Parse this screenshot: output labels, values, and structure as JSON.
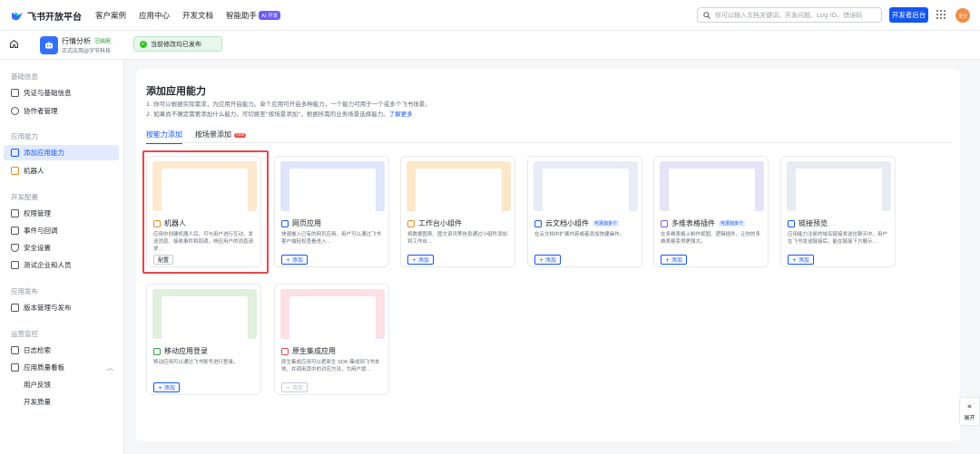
{
  "topbar": {
    "brand": "飞书开放平台",
    "nav": [
      "客户案例",
      "应用中心",
      "开发文档",
      "智能助手"
    ],
    "ai_badge": "AI 开发",
    "search_placeholder": "你可以输入文档关键词、开发问题、Log ID、错误码",
    "dev_button": "开发者后台",
    "avatar_text": "企业"
  },
  "appbar": {
    "app_name": "行情分析",
    "app_tag": "已启用",
    "app_sub": "正式应用@字节科技",
    "publish_status": "当前修改均已发布"
  },
  "sidebar": {
    "sections": [
      {
        "title": "基础信息",
        "items": [
          "凭证与基础信息",
          "协作者管理"
        ]
      },
      {
        "title": "应用能力",
        "items": [
          "添加应用能力",
          "机器人"
        ]
      },
      {
        "title": "开发配置",
        "items": [
          "权限管理",
          "事件与回调",
          "安全设置",
          "测试企业和人员"
        ]
      },
      {
        "title": "应用发布",
        "items": [
          "版本管理与发布"
        ]
      },
      {
        "title": "运营监控",
        "items": [
          "日志检索",
          "应用质量看板",
          "用户反馈",
          "开发质量"
        ]
      }
    ]
  },
  "main": {
    "title": "添加应用能力",
    "desc1": "1. 你可以根据实际需求，为应用开启能力。单个应用可开启多种能力，一个能力可用于一个或多个飞书场景。",
    "desc2": "2. 如果尚不确定需要添加什么能力，可切换至\"按场景添加\"，根据所需的业务场景选择能力。",
    "desc2_link": "了解更多",
    "tabs": [
      "按能力添加",
      "按场景添加"
    ],
    "new_badge": "new"
  },
  "cards": [
    {
      "title": "机器人",
      "tag": "",
      "desc": "应用中创建机器人后，可与用户进行互动、发送消息、接收事件和回调，响应用户的消息请求…",
      "button": "配置"
    },
    {
      "title": "网页应用",
      "tag": "",
      "desc": "快速嵌入已有的网页应用，用户可以通过飞书客户端轻松查看进入…",
      "button": "+ 添加"
    },
    {
      "title": "工作台小组件",
      "tag": "",
      "desc": "将数据图表、图文资讯等信息通过小组件添加到工作台…",
      "button": "+ 添加"
    },
    {
      "title": "云文档小组件",
      "tag": "可添加多个",
      "desc": "在云文档中扩展内容或者添加快捷操作。",
      "button": "+ 添加"
    },
    {
      "title": "多维表格插件",
      "tag": "可添加多个",
      "desc": "在多维表格上制作视图、逻辑插件，让你的多维表格变得更强大。",
      "button": "+ 添加"
    },
    {
      "title": "链接预览",
      "tag": "",
      "desc": "应用能力注册的域名链接发送在聊天中，用户在飞书发送链接后，能在链接下方展示…",
      "button": "+ 添加"
    },
    {
      "title": "移动应用登录",
      "tag": "",
      "desc": "移动应用可以通过飞书账号进行登录。",
      "button": "+ 添加"
    },
    {
      "title": "原生集成应用",
      "tag": "",
      "desc": "原生集成应用可以把原生 SDK 集成到飞书本地，并调用其中的对应方法，为用户提…",
      "button": "+ 添加"
    }
  ],
  "expand_label": "展开",
  "colors": {
    "accent": "#1456f0",
    "highlight": "#e5484d"
  }
}
